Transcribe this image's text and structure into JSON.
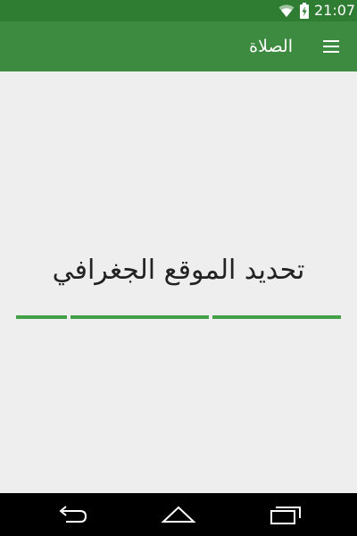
{
  "status_bar": {
    "time": "21:07",
    "icons": [
      "wifi-icon",
      "battery-charging-icon"
    ]
  },
  "toolbar": {
    "title": "الصلاة",
    "menu_icon": "menu-icon"
  },
  "main": {
    "message": "تحديد الموقع الجغرافي"
  },
  "nav_bar": {
    "icons": [
      "back-icon",
      "home-icon",
      "recent-apps-icon"
    ]
  },
  "colors": {
    "status_bar": "#2e7d32",
    "toolbar": "#3d8b40",
    "progress": "#43a047",
    "background": "#eeeeee",
    "nav_bar": "#000000"
  }
}
